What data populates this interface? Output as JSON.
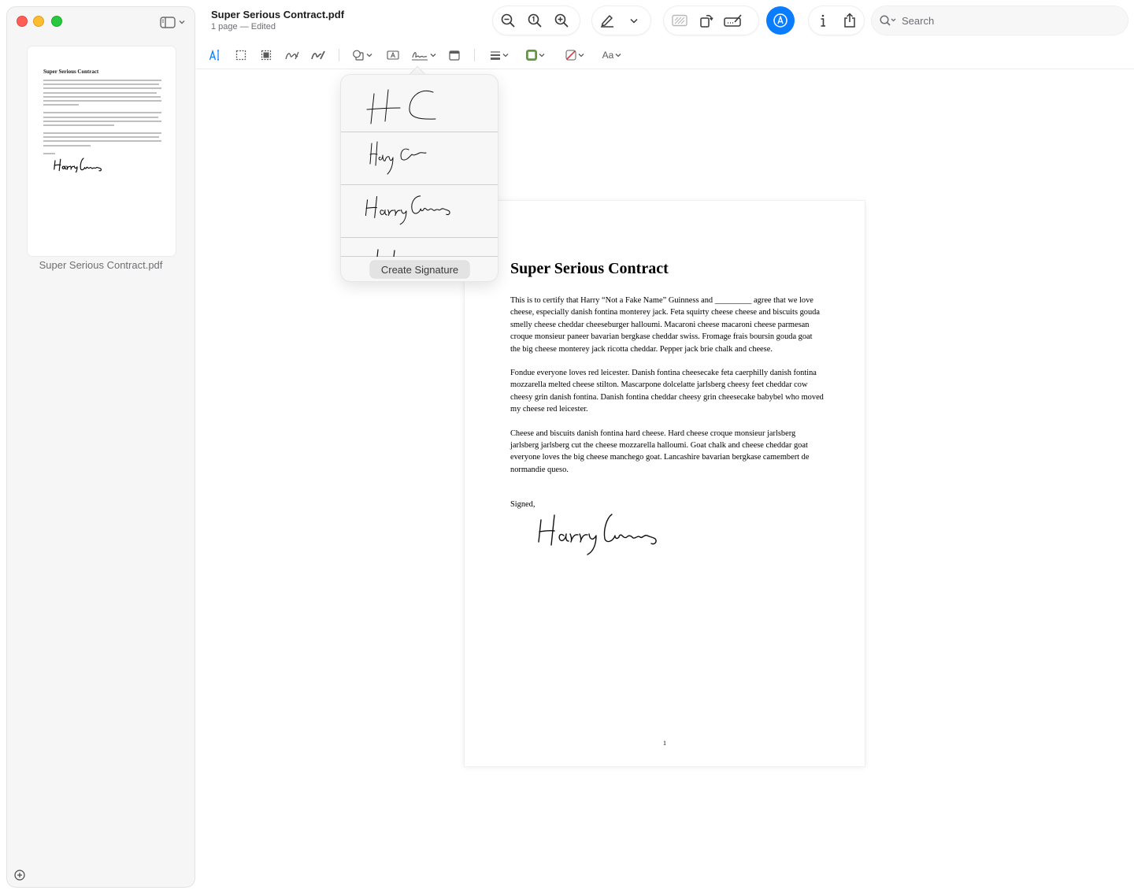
{
  "window": {
    "title": "Super Serious Contract.pdf",
    "subtitle": "1 page — Edited"
  },
  "sidebar": {
    "thumbnail_title": "Super Serious Contract",
    "thumbnail_caption": "Super Serious Contract.pdf"
  },
  "toolbar": {
    "search_placeholder": "Search",
    "text_style_label": "Aa",
    "icons": [
      "zoom-out-icon",
      "actual-size-icon",
      "zoom-in-icon",
      "highlight-pen-icon",
      "chevron-down-icon",
      "redact-icon",
      "rotate-icon",
      "form-fill-icon",
      "markup-icon",
      "info-icon",
      "share-icon",
      "search-icon"
    ]
  },
  "annotation_bar": {
    "icons": [
      "text-selection-icon",
      "rect-select-icon",
      "redact-select-icon",
      "sketch-icon",
      "draw-icon",
      "shapes-icon",
      "text-box-icon",
      "sign-icon",
      "note-icon",
      "shape-style-icon",
      "border-color-icon",
      "fill-color-icon",
      "text-style-icon"
    ],
    "border_color": "#5f9a3a",
    "fill_color": "#e0393e"
  },
  "signature_popover": {
    "create_label": "Create Signature",
    "signatures": [
      "signature-initials",
      "signature-short",
      "signature-full",
      "signature-partial"
    ]
  },
  "document": {
    "title": "Super Serious Contract",
    "paragraph1": "This is to certify that Harry “Not a Fake Name” Guinness and _________ agree that we love cheese, especially danish fontina monterey jack. Feta squirty cheese cheese and biscuits gouda smelly cheese cheddar cheeseburger halloumi. Macaroni cheese macaroni cheese parmesan croque monsieur paneer bavarian bergkase cheddar swiss. Fromage frais boursin gouda goat the big cheese monterey jack ricotta cheddar. Pepper jack brie chalk and cheese.",
    "paragraph2": "Fondue everyone loves red leicester. Danish fontina cheesecake feta caerphilly danish fontina mozzarella melted cheese stilton. Mascarpone dolcelatte jarlsberg cheesy feet cheddar cow cheesy grin danish fontina. Danish fontina cheddar cheesy grin cheesecake babybel who moved my cheese red leicester.",
    "paragraph3": "Cheese and biscuits danish fontina hard cheese. Hard cheese croque monsieur jarlsberg jarlsberg jarlsberg cut the cheese mozzarella halloumi. Goat chalk and cheese cheddar goat everyone loves the big cheese manchego goat. Lancashire bavarian bergkase camembert de normandie queso.",
    "signed_label": "Signed,",
    "page_number": "1"
  }
}
